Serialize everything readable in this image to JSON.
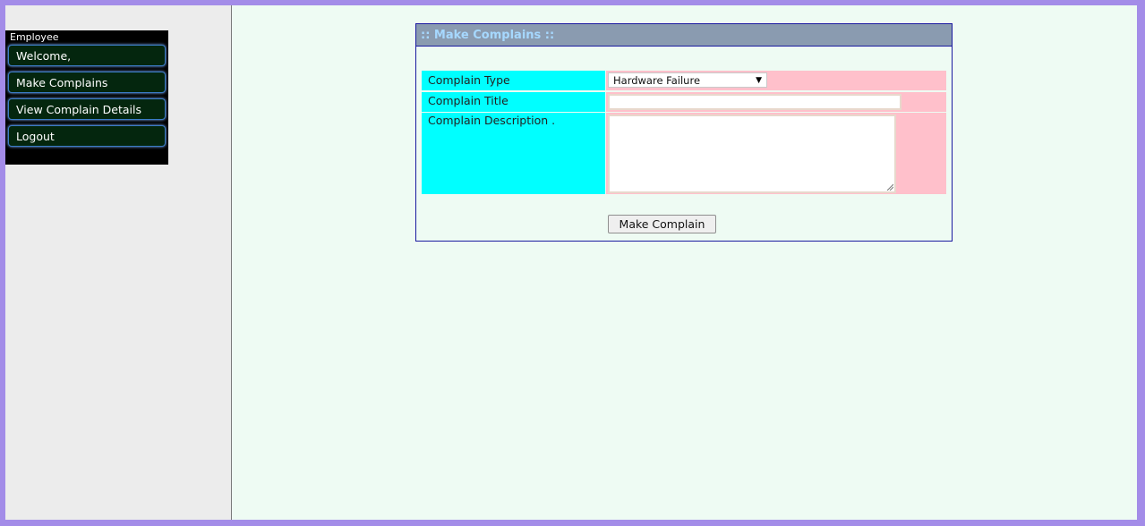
{
  "sidebar": {
    "menu_title": "Employee",
    "items": [
      {
        "label": "Welcome,"
      },
      {
        "label": "Make Complains"
      },
      {
        "label": "View Complain Details"
      },
      {
        "label": "Logout"
      }
    ]
  },
  "panel": {
    "title": ":: Make Complains ::",
    "fields": {
      "type_label": "Complain Type",
      "type_value": "Hardware Failure",
      "title_label": "Complain Title",
      "title_value": "",
      "description_label": "Complain Description .",
      "description_value": ""
    },
    "submit_label": "Make Complain"
  },
  "colors": {
    "page_border": "#a38ce8",
    "content_bg": "#eefbf3",
    "sidebar_bg": "#ececec",
    "menu_item_bg": "#04260e",
    "label_bg": "#00ffff",
    "value_bg": "#ffc0cb",
    "panel_header_bg": "#8a9bb0",
    "panel_header_text": "#a6d8ff"
  },
  "icons": {
    "select_arrow": "triangle-down-icon",
    "textarea_resize": "resize-grip-icon"
  }
}
